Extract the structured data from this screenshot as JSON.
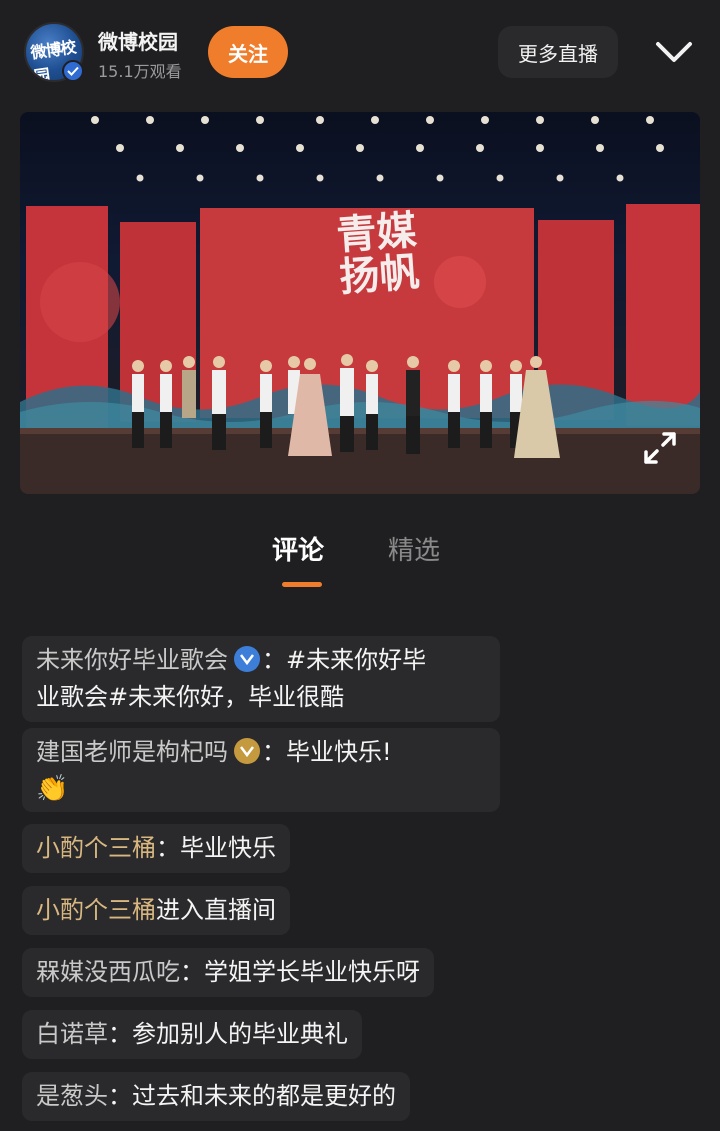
{
  "header": {
    "account_name": "微博校园",
    "viewer_count": "15.1万观看",
    "follow_label": "关注",
    "more_live_label": "更多直播",
    "avatar_text": "微博校园"
  },
  "video": {
    "stage_title": "青媒扬帆"
  },
  "tabs": [
    {
      "label": "评论",
      "active": true
    },
    {
      "label": "精选",
      "active": false
    }
  ],
  "comments": [
    {
      "user": "未来你好毕业歌会",
      "badge": "blue-verified-icon",
      "line1": "#未来你好毕",
      "line2": "业歌会#未来你好，毕业很酷"
    },
    {
      "user": "建国老师是枸杞吗",
      "badge": "gold-verified-icon",
      "text": "毕业快乐!"
    },
    {
      "user": "小酌个三桶",
      "text": "毕业快乐"
    },
    {
      "user": "小酌个三桶",
      "text": "进入直播间"
    },
    {
      "user": "槑媒没西瓜吃",
      "text": "学姐学长毕业快乐呀"
    },
    {
      "user": "白诺草",
      "text": "参加别人的毕业典礼"
    },
    {
      "user": "是葱头",
      "text": "过去和未来的都是更好的"
    }
  ],
  "colors": {
    "accent": "#f07d2c",
    "background": "#1f1f21",
    "bubble": "#2a2a2c",
    "username_gold": "#d8b780"
  }
}
